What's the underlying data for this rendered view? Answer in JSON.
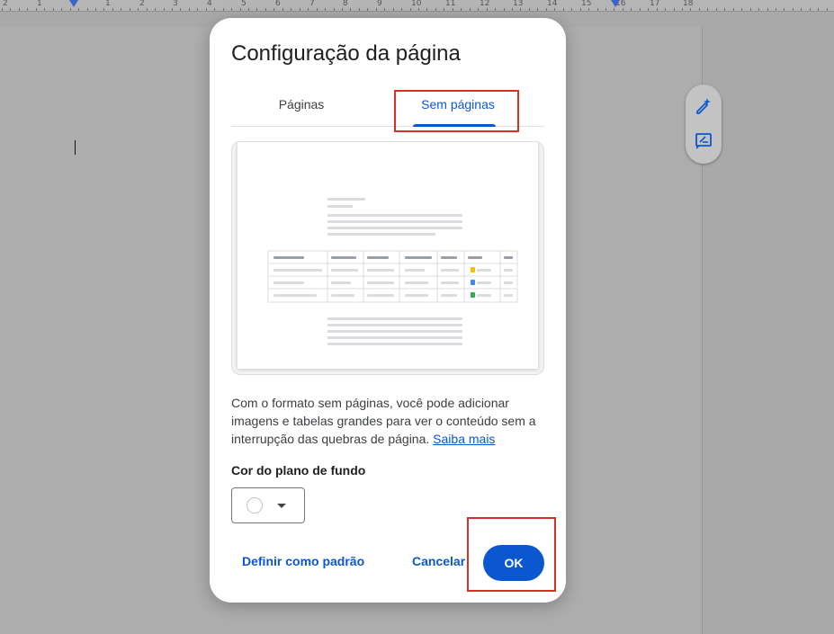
{
  "ruler": {
    "numbers": [
      "2",
      "1",
      "1",
      "2",
      "3",
      "4",
      "5",
      "6",
      "7",
      "8",
      "9",
      "10",
      "11",
      "12",
      "13",
      "14",
      "15",
      "16",
      "17",
      "18"
    ]
  },
  "dialog": {
    "title": "Configuração da página",
    "tabs": [
      {
        "label": "Páginas",
        "selected": false
      },
      {
        "label": "Sem páginas",
        "selected": true
      }
    ],
    "description": "Com o formato sem páginas, você pode adicionar imagens e tabelas grandes para ver o conteúdo sem a interrupção das quebras de página.",
    "learn_more": "Saiba mais",
    "background_label": "Cor do plano de fundo",
    "background_color": "#ffffff",
    "set_default_label": "Definir como padrão",
    "cancel_label": "Cancelar",
    "ok_label": "OK"
  },
  "side_tools": [
    "edit-sparkle-icon",
    "comment-icon"
  ],
  "colors": {
    "accent": "#0b57d0",
    "highlight": "#d93025",
    "backdrop": "#a9a9a9"
  }
}
